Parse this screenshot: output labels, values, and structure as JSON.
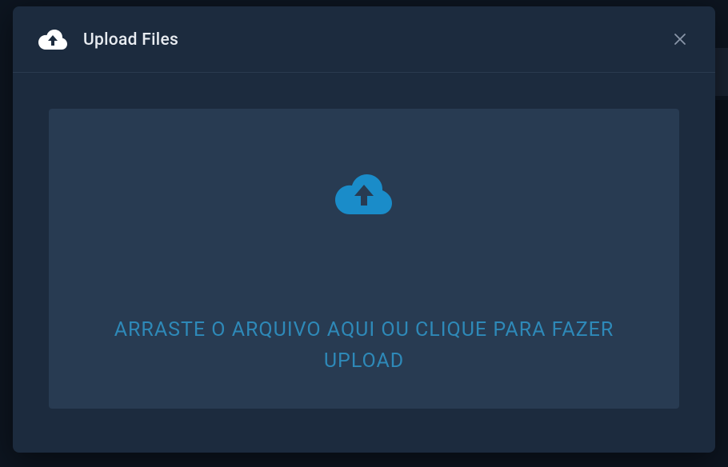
{
  "modal": {
    "title": "Upload Files",
    "dropzone": {
      "text": "ARRASTE O ARQUIVO AQUI OU CLIQUE PARA FAZER UPLOAD"
    }
  },
  "colors": {
    "accent": "#2e89b8",
    "dropzoneIcon": "#1a8cc9"
  }
}
